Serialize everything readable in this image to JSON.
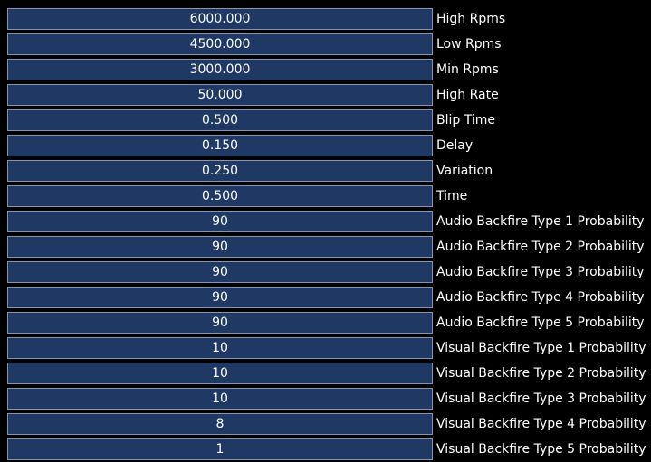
{
  "colors": {
    "background": "#000000",
    "field_fill": "#1f3864",
    "field_border": "#8296b4",
    "text": "#ffffff"
  },
  "rows": [
    {
      "value": "6000.000",
      "label": "High Rpms"
    },
    {
      "value": "4500.000",
      "label": "Low Rpms"
    },
    {
      "value": "3000.000",
      "label": "Min Rpms"
    },
    {
      "value": "50.000",
      "label": "High Rate"
    },
    {
      "value": "0.500",
      "label": "Blip Time"
    },
    {
      "value": "0.150",
      "label": "Delay"
    },
    {
      "value": "0.250",
      "label": "Variation"
    },
    {
      "value": "0.500",
      "label": "Time"
    },
    {
      "value": "90",
      "label": "Audio Backfire Type 1 Probability"
    },
    {
      "value": "90",
      "label": "Audio Backfire Type 2 Probability"
    },
    {
      "value": "90",
      "label": "Audio Backfire Type 3 Probability"
    },
    {
      "value": "90",
      "label": "Audio Backfire Type 4 Probability"
    },
    {
      "value": "90",
      "label": "Audio Backfire Type 5 Probability"
    },
    {
      "value": "10",
      "label": "Visual Backfire Type 1 Probability"
    },
    {
      "value": "10",
      "label": "Visual Backfire Type 2 Probability"
    },
    {
      "value": "10",
      "label": "Visual Backfire Type 3 Probability"
    },
    {
      "value": "8",
      "label": "Visual Backfire Type 4 Probability"
    },
    {
      "value": "1",
      "label": "Visual Backfire Type 5 Probability"
    }
  ]
}
